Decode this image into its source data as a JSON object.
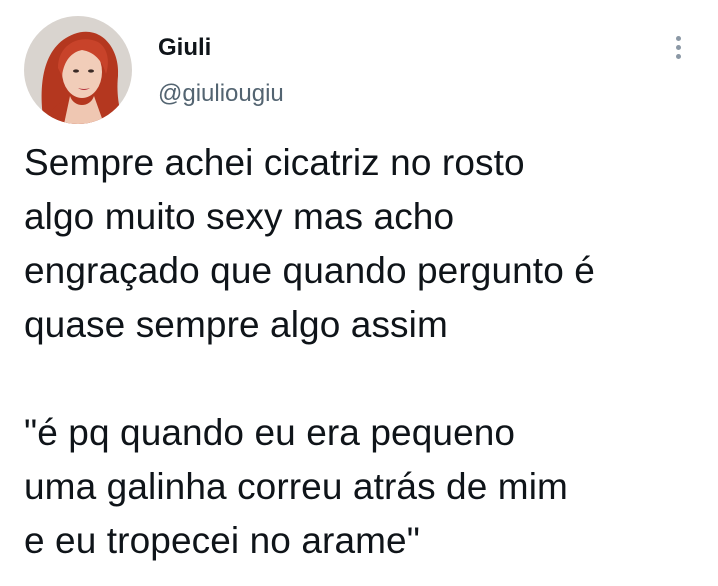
{
  "author": {
    "display_name": "Giuli",
    "handle": "@giuliougiu",
    "avatar_icon": "profile-photo-red-hair"
  },
  "more_icon": "more-vertical-icon",
  "tweet": {
    "paragraph1": [
      "Sempre achei cicatriz no rosto",
      "algo muito sexy mas acho",
      "engraçado que quando pergunto é",
      "quase sempre algo assim"
    ],
    "paragraph2": [
      "\"é pq quando eu era pequeno",
      "uma galinha correu atrás de mim",
      "e eu tropecei no arame\""
    ]
  },
  "colors": {
    "text": "#0f1419",
    "secondary_text": "#536471",
    "background": "#ffffff"
  }
}
